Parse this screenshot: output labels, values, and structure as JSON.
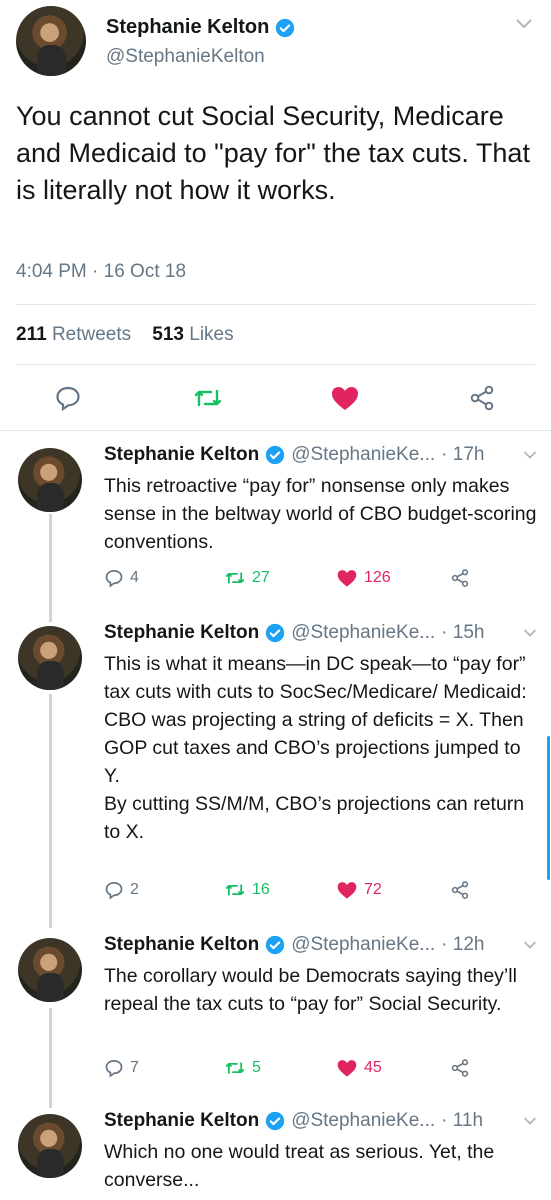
{
  "main": {
    "name": "Stephanie Kelton",
    "handle": "@StephanieKelton",
    "text": "You cannot cut Social Security, Medicare and Medicaid to \"pay for\" the tax cuts. That is literally not how it works.",
    "time": "4:04 PM · 16 Oct 18",
    "retweets_count": "211",
    "retweets_label": "Retweets",
    "likes_count": "513",
    "likes_label": "Likes"
  },
  "replies": [
    {
      "name": "Stephanie Kelton",
      "handle": "@StephanieKe...",
      "time": "· 17h",
      "text": "This retroactive “pay for” nonsense only makes sense in the beltway world of CBO budget-scoring conventions.",
      "replies": "4",
      "retweets": "27",
      "likes": "126"
    },
    {
      "name": "Stephanie Kelton",
      "handle": "@StephanieKe...",
      "time": "· 15h",
      "text": "This is what it means—in DC speak—to “pay for” tax cuts with cuts to SocSec/Medicare/ Medicaid:\nCBO was projecting a string of deficits = X. Then GOP cut taxes and CBO’s projections jumped to Y.\nBy cutting SS/M/M, CBO’s projections can return to X.",
      "replies": "2",
      "retweets": "16",
      "likes": "72"
    },
    {
      "name": "Stephanie Kelton",
      "handle": "@StephanieKe...",
      "time": "· 12h",
      "text": "The corollary would be Democrats saying they’ll repeal the tax cuts to “pay for” Social Security.",
      "replies": "7",
      "retweets": "5",
      "likes": "45"
    },
    {
      "name": "Stephanie Kelton",
      "handle": "@StephanieKe...",
      "time": "· 11h",
      "text": "Which no one would treat as serious. Yet, the converse..."
    }
  ],
  "colors": {
    "blue": "#1da1f2",
    "green": "#17bf63",
    "red": "#e0245e",
    "gray": "#657786"
  },
  "icons": [
    "verified-icon",
    "chevron-down-icon",
    "reply-icon",
    "retweet-icon",
    "like-icon",
    "share-icon"
  ]
}
